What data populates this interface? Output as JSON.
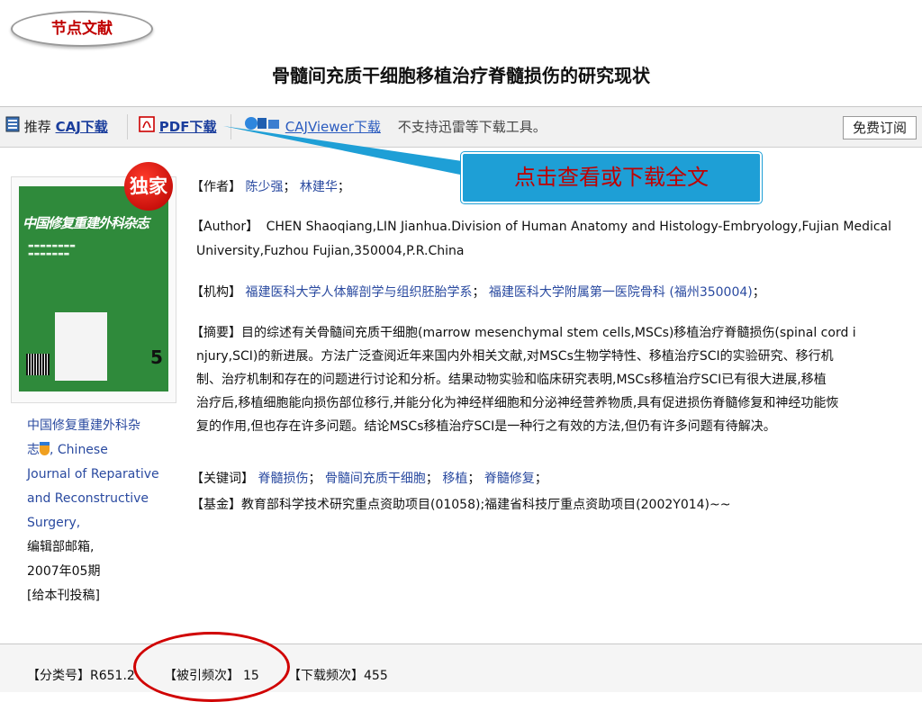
{
  "header": {
    "badge": "节点文献",
    "title": "骨髓间充质干细胞移植治疗脊髓损伤的研究现状"
  },
  "toolbar": {
    "recommend": "推荐",
    "caj_label": "CAJ下载",
    "pdf_label": "PDF下载",
    "cajviewer_label": "CAJViewer下载",
    "note": "不支持迅雷等下载工具。",
    "subscribe_label": "免费订阅"
  },
  "callout": "点击查看或下载全文",
  "cover": {
    "exclusive": "独家",
    "title": "中国修复重建外科杂志",
    "issue": "5"
  },
  "journal": {
    "name_cn_1": "中国修复重建外科杂",
    "name_cn_2": "志",
    "name_en_1": ", Chinese",
    "name_en_2": "Journal of Reparative",
    "name_en_3": "and Reconstructive",
    "name_en_4": "Surgery,",
    "office": "编辑部邮箱,",
    "issue": "2007年05期",
    "submit": "[给本刊投稿]"
  },
  "authors": {
    "label": "【作者】",
    "names": [
      "陈少强",
      "林建华"
    ]
  },
  "author_en": {
    "label": "【Author】",
    "line1": "CHEN Shaoqiang,LIN Jianhua.Division of Human Anatomy and Histology-Embryology,Fujian Medical",
    "line2": "University,Fuzhou Fujian,350004,P.R.China"
  },
  "institution": {
    "label": "【机构】",
    "items": [
      "福建医科大学人体解剖学与组织胚胎学系",
      "福建医科大学附属第一医院骨科 (福州350004)"
    ]
  },
  "abstract": {
    "label": "【摘要】",
    "lines": [
      "目的综述有关骨髓间充质干细胞(marrow mesenchymal stem cells,MSCs)移植治疗脊髓损伤(spinal cord i",
      "njury,SCI)的新进展。方法广泛查阅近年来国内外相关文献,对MSCs生物学特性、移植治疗SCI的实验研究、移行机",
      "制、治疗机制和存在的问题进行讨论和分析。结果动物实验和临床研究表明,MSCs移植治疗SCI已有很大进展,移植",
      "治疗后,移植细胞能向损伤部位移行,并能分化为神经样细胞和分泌神经营养物质,具有促进损伤脊髓修复和神经功能恢",
      "复的作用,但也存在许多问题。结论MSCs移植治疗SCI是一种行之有效的方法,但仍有许多问题有待解决。"
    ]
  },
  "keywords": {
    "label": "【关键词】",
    "items": [
      "脊髓损伤",
      "骨髓间充质干细胞",
      "移植",
      "脊髓修复"
    ]
  },
  "fund": {
    "label": "【基金】",
    "text": "教育部科学技术研究重点资助项目(01058);福建省科技厅重点资助项目(2002Y014)~~"
  },
  "stats": {
    "class_label": "【分类号】",
    "class_value": "R651.2",
    "cited_label": "【被引频次】",
    "cited_value": "15",
    "download_label": "【下载频次】",
    "download_value": "455"
  }
}
